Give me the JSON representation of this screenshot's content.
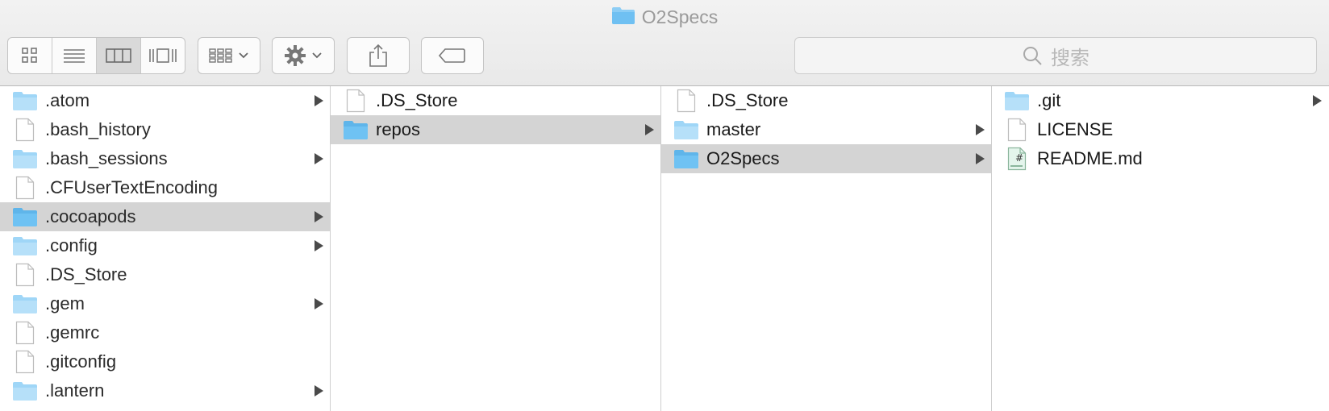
{
  "window": {
    "title": "O2Specs"
  },
  "toolbar": {
    "view_modes": [
      "icon-view",
      "list-view",
      "column-view",
      "cover-flow-view"
    ],
    "active_view": "column-view",
    "search_placeholder": "搜索"
  },
  "columns": [
    {
      "items": [
        {
          "name": ".atom",
          "kind": "folder",
          "arrow": true
        },
        {
          "name": ".bash_history",
          "kind": "file"
        },
        {
          "name": ".bash_sessions",
          "kind": "folder",
          "arrow": true
        },
        {
          "name": ".CFUserTextEncoding",
          "kind": "file"
        },
        {
          "name": ".cocoapods",
          "kind": "folder",
          "arrow": true,
          "selected": true
        },
        {
          "name": ".config",
          "kind": "folder",
          "arrow": true
        },
        {
          "name": ".DS_Store",
          "kind": "file"
        },
        {
          "name": ".gem",
          "kind": "folder",
          "arrow": true
        },
        {
          "name": ".gemrc",
          "kind": "file"
        },
        {
          "name": ".gitconfig",
          "kind": "file"
        },
        {
          "name": ".lantern",
          "kind": "folder",
          "arrow": true
        }
      ]
    },
    {
      "items": [
        {
          "name": ".DS_Store",
          "kind": "file"
        },
        {
          "name": "repos",
          "kind": "folder",
          "arrow": true,
          "selected": true
        }
      ]
    },
    {
      "items": [
        {
          "name": ".DS_Store",
          "kind": "file"
        },
        {
          "name": "master",
          "kind": "folder",
          "arrow": true
        },
        {
          "name": "O2Specs",
          "kind": "folder",
          "arrow": true,
          "selected": true
        }
      ]
    },
    {
      "items": [
        {
          "name": ".git",
          "kind": "folder",
          "arrow": true
        },
        {
          "name": "LICENSE",
          "kind": "file"
        },
        {
          "name": "README.md",
          "kind": "markdown"
        }
      ]
    }
  ],
  "colors": {
    "folder": "#8ccdf5",
    "folder_dark": "#5fb5ea",
    "selection": "#d4d4d4"
  }
}
